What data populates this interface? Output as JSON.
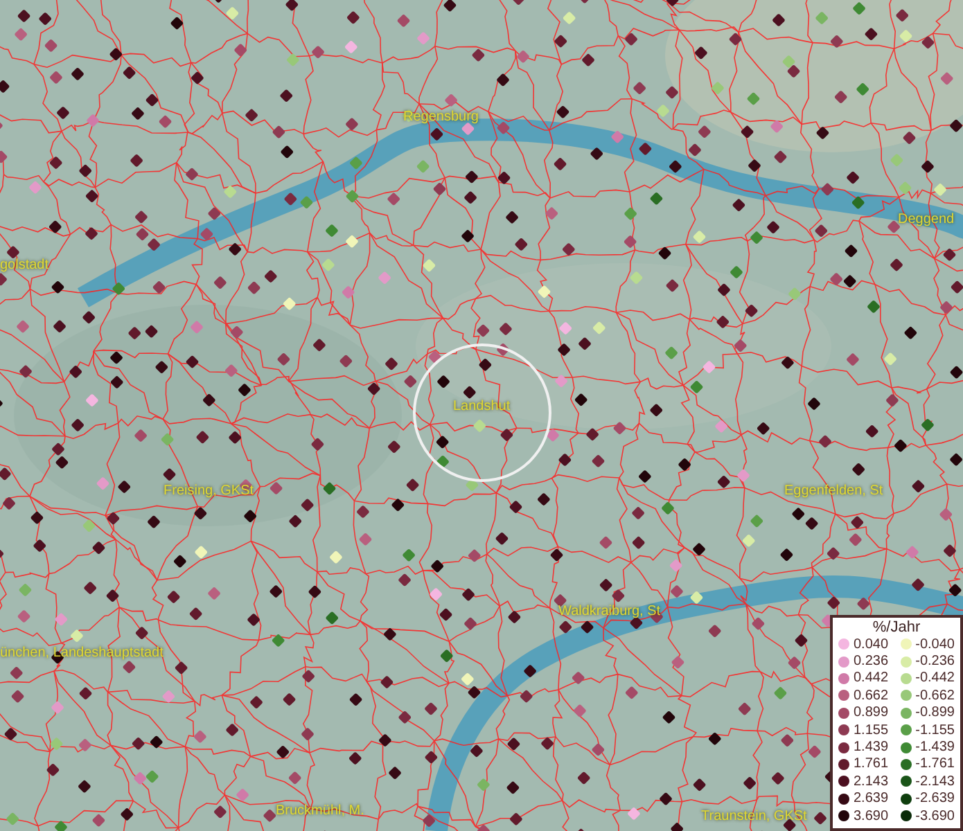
{
  "map_labels": [
    "Regensburg",
    "golstadt",
    "Deggend",
    "Landshut",
    "Freising, GKSt",
    "Eggenfelden, St",
    "Waldkraiburg, St",
    "ünchen, Landeshauptstadt",
    "Bruckmühl, M.",
    "Traunstein, GKSt"
  ],
  "legend": {
    "title": "%/Jahr",
    "rows": [
      {
        "positive": {
          "value": "0.040",
          "color": "#f4b6e0"
        },
        "negative": {
          "value": "-0.040",
          "color": "#f0f5b8"
        }
      },
      {
        "positive": {
          "value": "0.236",
          "color": "#e39ac8"
        },
        "negative": {
          "value": "-0.236",
          "color": "#d8eca6"
        }
      },
      {
        "positive": {
          "value": "0.442",
          "color": "#d07aa8"
        },
        "negative": {
          "value": "-0.442",
          "color": "#b8db90"
        }
      },
      {
        "positive": {
          "value": "0.662",
          "color": "#b9607f"
        },
        "negative": {
          "value": "-0.662",
          "color": "#98c878"
        }
      },
      {
        "positive": {
          "value": "0.899",
          "color": "#a44a66"
        },
        "negative": {
          "value": "-0.899",
          "color": "#7ab562"
        }
      },
      {
        "positive": {
          "value": "1.155",
          "color": "#8e3a52"
        },
        "negative": {
          "value": "-1.155",
          "color": "#5a9f48"
        }
      },
      {
        "positive": {
          "value": "1.439",
          "color": "#7a2a40"
        },
        "negative": {
          "value": "-1.439",
          "color": "#3f8a34"
        }
      },
      {
        "positive": {
          "value": "1.761",
          "color": "#621a2c"
        },
        "negative": {
          "value": "-1.761",
          "color": "#2a6e24"
        }
      },
      {
        "positive": {
          "value": "2.143",
          "color": "#4c1020"
        },
        "negative": {
          "value": "-2.143",
          "color": "#1a5418"
        }
      },
      {
        "positive": {
          "value": "2.639",
          "color": "#360a14"
        },
        "negative": {
          "value": "-2.639",
          "color": "#0f3e0e"
        }
      },
      {
        "positive": {
          "value": "3.690",
          "color": "#22050a"
        },
        "negative": {
          "value": "-3.690",
          "color": "#0a2a08"
        }
      }
    ]
  }
}
